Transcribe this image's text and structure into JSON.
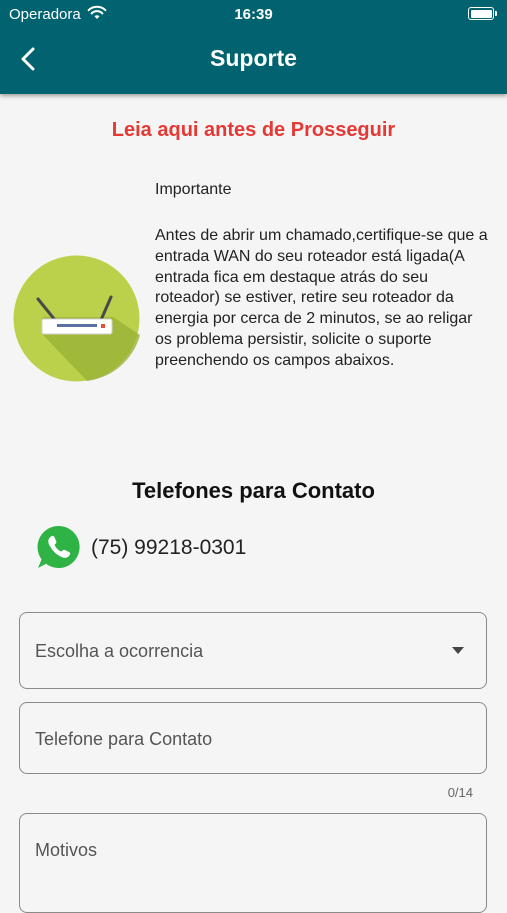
{
  "status_bar": {
    "carrier": "Operadora",
    "time": "16:39"
  },
  "header": {
    "title": "Suporte",
    "back_icon": "chevron-left-icon",
    "color": "#00636f"
  },
  "notice": {
    "title": "Leia aqui antes de Prosseguir",
    "title_color": "#e53935",
    "label": "Importante",
    "text": "Antes de abrir um chamado,certifique-se que a entrada WAN do seu roteador está ligada(A entrada fica em destaque atrás do seu roteador) se estiver, retire seu roteador da energia por cerca de 2 minutos, se ao religar os problema persistir, solicite o suporte preenchendo os campos abaixos.",
    "icon": "router-icon"
  },
  "contact": {
    "title": "Telefones para Contato",
    "icon": "whatsapp-icon",
    "phone": "(75) 99218-0301"
  },
  "form": {
    "occurrence": {
      "placeholder": "Escolha a ocorrencia"
    },
    "phone": {
      "placeholder": "Telefone para Contato",
      "counter": "0/14"
    },
    "reasons": {
      "placeholder": "Motivos"
    }
  }
}
